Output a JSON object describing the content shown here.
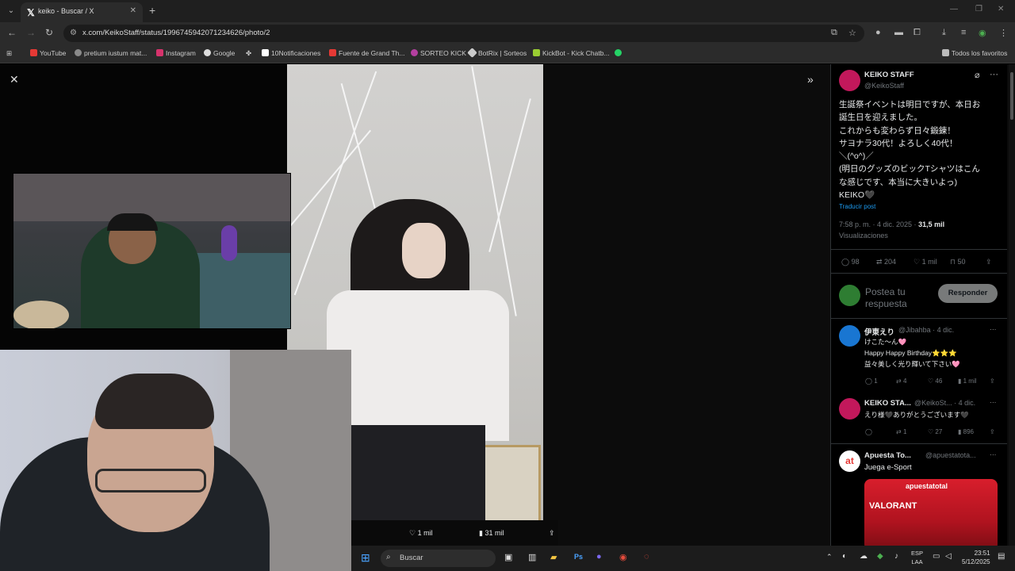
{
  "browser": {
    "tab_title": "keiko - Buscar / X",
    "url": "x.com/KeikoStaff/status/1996745942071234626/photo/2",
    "bookmarks": [
      "YouTube",
      "pretium iustum mat...",
      "Instagram",
      "Google",
      "10Notificaciones",
      "Fuente de Grand Th...",
      "SORTEO KICK",
      "BotRix | Sorteos",
      "KickBot - Kick Chatb..."
    ],
    "all_bookmarks": "Todos los favoritos"
  },
  "photo_actions": {
    "reposts": "204",
    "likes": "1 mil",
    "views": "31 mil"
  },
  "post": {
    "name": "KEIKO STAFF",
    "handle": "@KeikoStaff",
    "text": "生誕祭イベントは明日ですが、本日お\n誕生日を迎えました。\nこれからも変わらず日々鍛錬！\nサヨナラ30代！よろしく40代！\n＼(^o^)／\n(明日のグッズのビックTシャツはこん\nな感じです、本当に大きいよっ)\nKEIKO🖤",
    "translate": "Traducir post",
    "timestamp": "7:58 p. m. · 4 dic. 2025 · ",
    "views_count": "31,5 mil",
    "views_label": "Visualizaciones",
    "replies": "98",
    "reposts": "204",
    "likes": "1 mil",
    "bookmarks": "50"
  },
  "reply_box": {
    "placeholder": "Postea tu respuesta",
    "button": "Responder"
  },
  "replies": [
    {
      "name": "伊東えり",
      "handle": "@Jibahba · 4 dic.",
      "line1": "けこた〜ん🩷",
      "line2": "Happy Happy Birthday⭐⭐⭐",
      "line3": "益々美しく光り輝いて下さい🩷",
      "replies": "1",
      "reposts": "4",
      "likes": "46",
      "views": "1 mil"
    },
    {
      "name": "KEIKO STA...",
      "handle": "@KeikoSt... · 4 dic.",
      "line1": "えり様🖤ありがとうございます🖤",
      "replies": "",
      "reposts": "1",
      "likes": "27",
      "views": "896"
    }
  ],
  "ad": {
    "name": "Apuesta To...",
    "handle": "@apuestatota...",
    "text": "Juega e-Sport",
    "brand": "apuestatotal",
    "game": "VALORANT"
  },
  "taskbar": {
    "search": "Buscar",
    "lang1": "ESP",
    "lang2": "LAA",
    "time": "23:51",
    "date": "5/12/2025"
  },
  "colors": {
    "accent": "#1d9bf0",
    "background": "#000000",
    "muted": "#71767b"
  }
}
